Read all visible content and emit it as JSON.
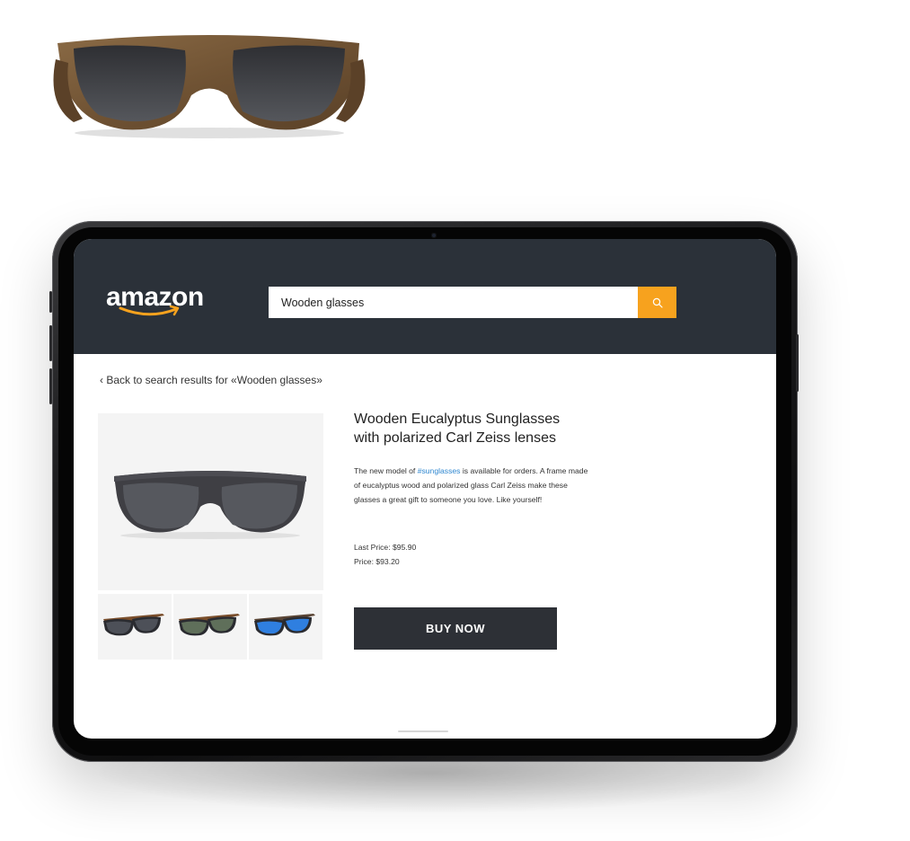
{
  "header": {
    "logo_text": "amazon",
    "search_value": "Wooden glasses",
    "search_icon": "search-icon"
  },
  "breadcrumb": {
    "back_text": "‹ Back to search results for «Wooden glasses»"
  },
  "product": {
    "title_line1": "Wooden Eucalyptus Sunglasses",
    "title_line2": "with polarized Carl Zeiss lenses",
    "description_before": "The new model of ",
    "description_tag": "#sunglasses",
    "description_after": " is available for orders. A frame made of eucalyptus wood and polarized glass Carl Zeiss make these glasses a great gift to someone you love. Like yourself!",
    "last_price": "Last Price: $95.90",
    "price": "Price: $93.20",
    "buy_label": "BUY NOW"
  },
  "colors": {
    "header_bg": "#2b3139",
    "accent": "#f7a21e",
    "button_bg": "#2d3036",
    "link": "#2f87d0"
  }
}
